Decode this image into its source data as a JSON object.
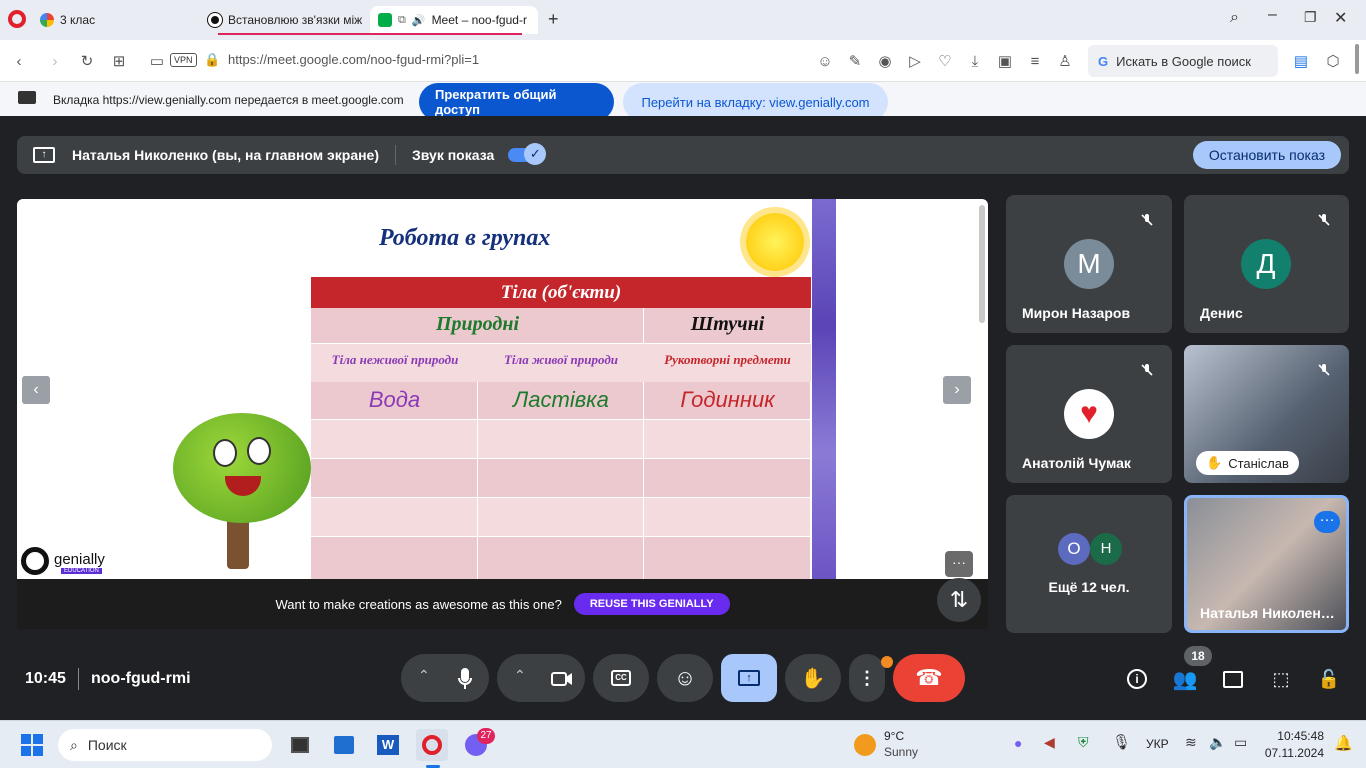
{
  "tabs": [
    {
      "label": "3 клас"
    },
    {
      "label": "Встановлюю зв'язки між"
    },
    {
      "label": "Meet – noo-fgud-r"
    }
  ],
  "address": {
    "url": "https://meet.google.com/noo-fgud-rmi?pli=1",
    "vpn": "VPN",
    "search_placeholder": "Искать в Google поиск"
  },
  "share_banner": {
    "text": "Вкладка https://view.genially.com передается в meet.google.com",
    "stop_label": "Прекратить общий доступ",
    "goto_label": "Перейти на вкладку: view.genially.com"
  },
  "presenting": {
    "name": "Наталья Николенко (вы, на главном экране)",
    "sound_label": "Звук показа",
    "stop_label": "Остановить показ"
  },
  "slide": {
    "title": "Робота в групах",
    "table_header": "Тіла (об'єкти)",
    "col_natural": "Природні",
    "col_artificial": "Штучні",
    "sub1": "Тіла неживої природи",
    "sub2": "Тіла живої природи",
    "sub3": "Рукотворні предмети",
    "row1": [
      "Вода",
      "Ластівка",
      "Годинник"
    ],
    "brand": "genially",
    "brand_sub": "EDUCATION"
  },
  "genially_banner": {
    "text": "Want to make creations as awesome as this one?",
    "button": "REUSE THIS GENIALLY"
  },
  "participants": [
    {
      "name": "Мирон Назаров",
      "initial": "М",
      "color": "#7a8c99"
    },
    {
      "name": "Денис",
      "initial": "Д",
      "color": "#12806c"
    },
    {
      "name": "Анатолій Чумак"
    },
    {
      "name": "Станіслав"
    },
    {
      "more_label": "Ещё 12 чел.",
      "o": "О",
      "h": "Н",
      "o_color": "#5c6bc0",
      "h_color": "#1b6b48"
    },
    {
      "name": "Наталья Николен…"
    }
  ],
  "meeting": {
    "time": "10:45",
    "code": "noo-fgud-rmi",
    "people_count": "18",
    "accent": "#ea4335"
  },
  "taskbar": {
    "search": "Поиск",
    "weather_temp": "9°C",
    "weather_desc": "Sunny",
    "lang": "УКР",
    "time": "10:45:48",
    "date": "07.11.2024",
    "viber_badge": "27"
  }
}
